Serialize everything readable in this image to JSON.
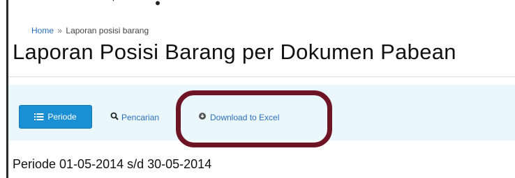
{
  "top_cut_text": "’ •",
  "breadcrumb": {
    "home": "Home",
    "separator": "»",
    "current": "Laporan posisi barang"
  },
  "page": {
    "title": "Laporan Posisi Barang per Dokumen Pabean"
  },
  "toolbar": {
    "periode_label": "Periode",
    "pencarian_label": "Pencarian",
    "download_label": "Download to Excel"
  },
  "periode_info": "Periode 01-05-2014 s/d 30-05-2014",
  "colors": {
    "primary_button": "#1b8fd4",
    "link": "#2a6fb8",
    "toolbar_bg": "#eaf8fd",
    "annotation": "#6e1525"
  },
  "icons": {
    "periode": "list-icon",
    "pencarian": "search-icon",
    "download": "download-icon"
  }
}
